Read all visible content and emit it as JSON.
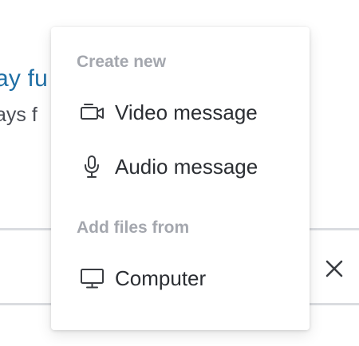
{
  "background": {
    "title_fragment": "ay fu",
    "subtitle_fragment": "ays f",
    "close_icon": "close-icon"
  },
  "menu": {
    "create_heading": "Create new",
    "create_items": [
      {
        "label": "Video message",
        "icon": "video-camera-icon"
      },
      {
        "label": "Audio message",
        "icon": "microphone-icon"
      }
    ],
    "files_heading": "Add files from",
    "files_items": [
      {
        "label": "Computer",
        "icon": "monitor-icon"
      }
    ]
  },
  "colors": {
    "link_blue": "#1f6fa5",
    "heading_gray": "#a4a7ae",
    "text_dark": "#2b2e33",
    "divider": "#dadce0"
  }
}
